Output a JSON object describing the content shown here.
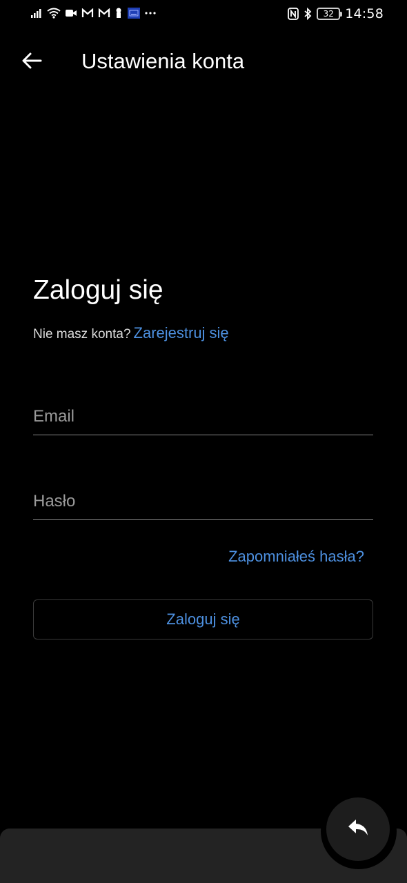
{
  "status_bar": {
    "time": "14:58",
    "battery_level": "32",
    "left_icons": [
      "signal-icon",
      "wifi-icon",
      "video-icon",
      "gmail-icon",
      "gmail-icon",
      "notification-icon",
      "keyboard-icon",
      "more-dots-icon"
    ],
    "right_icons": [
      "nfc-icon",
      "bluetooth-icon",
      "battery-icon"
    ]
  },
  "app_bar": {
    "title": "Ustawienia konta",
    "back_icon": "arrow-left-icon"
  },
  "login": {
    "title": "Zaloguj się",
    "no_account_text": "Nie masz konta?",
    "register_link": "Zarejestruj się",
    "email_placeholder": "Email",
    "password_placeholder": "Hasło",
    "forgot_password": "Zapomniałeś hasła?",
    "submit_label": "Zaloguj się"
  },
  "fab": {
    "icon": "reply-icon"
  },
  "colors": {
    "background": "#000000",
    "accent_link": "#4d90e0",
    "text_primary": "#ffffff",
    "placeholder": "#9a9a9a",
    "bottom_panel": "#232323"
  }
}
